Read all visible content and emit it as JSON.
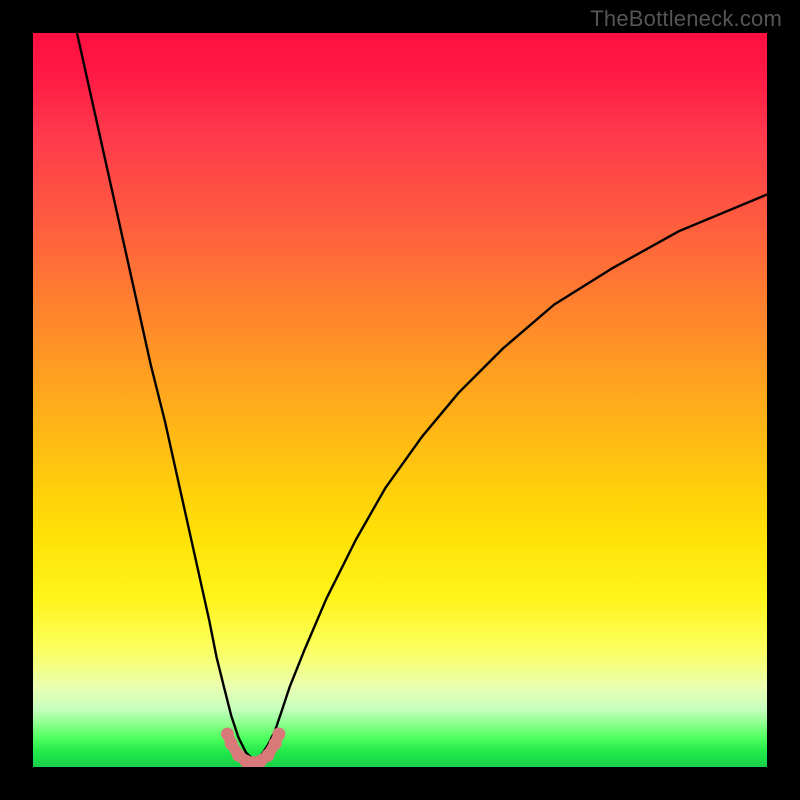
{
  "watermark": "TheBottleneck.com",
  "chart_data": {
    "type": "line",
    "title": "",
    "xlabel": "",
    "ylabel": "",
    "x_range": [
      0,
      100
    ],
    "y_range": [
      0,
      100
    ],
    "notes": "Bottleneck-style V-curve over a vertical red→yellow→green gradient. Y≈100 means severe bottleneck (top/red), Y≈0 means balanced (bottom/green). Minimum sits near x≈30 where the curve touches the green band; a small pink highlight marks the trough.",
    "series": [
      {
        "name": "bottleneck-curve",
        "x": [
          6,
          8,
          10,
          12,
          14,
          16,
          18,
          20,
          22,
          24,
          25,
          26,
          27,
          28,
          29,
          30,
          31,
          32,
          33,
          34,
          35,
          37,
          40,
          44,
          48,
          53,
          58,
          64,
          71,
          79,
          88,
          100
        ],
        "y": [
          100,
          91,
          82,
          73,
          64,
          55,
          47,
          38,
          29,
          20,
          15,
          11,
          7,
          4,
          2,
          1,
          1.5,
          3,
          5,
          8,
          11,
          16,
          23,
          31,
          38,
          45,
          51,
          57,
          63,
          68,
          73,
          78
        ]
      }
    ],
    "highlight": {
      "name": "optimal-range-marker",
      "color": "#d97a7a",
      "x": [
        26.5,
        27,
        28,
        29,
        30,
        31,
        32,
        33,
        33.5
      ],
      "y": [
        4.5,
        3.2,
        1.6,
        0.8,
        0.6,
        0.8,
        1.6,
        3.2,
        4.5
      ]
    },
    "gradient_stops": [
      {
        "pos": 0,
        "color": "#ff0f40"
      },
      {
        "pos": 50,
        "color": "#ffb812"
      },
      {
        "pos": 80,
        "color": "#fff838"
      },
      {
        "pos": 100,
        "color": "#18d048"
      }
    ]
  }
}
